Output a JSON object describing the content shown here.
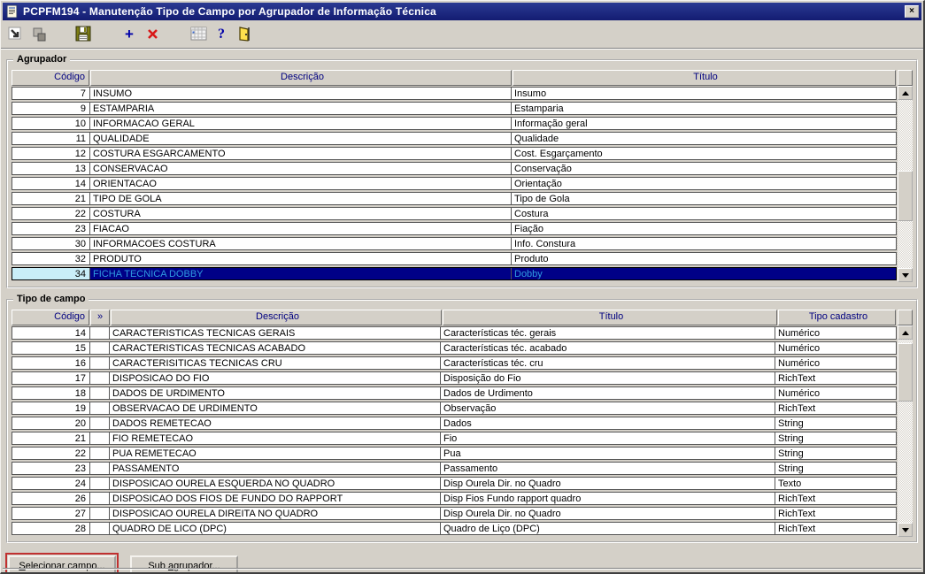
{
  "window": {
    "title": "PCPFM194 - Manutenção Tipo de Campo por Agrupador de Informação Técnica",
    "close_label": "×"
  },
  "toolbar": {
    "icons": [
      {
        "name": "window-arrow-icon"
      },
      {
        "name": "cascade-windows-icon"
      },
      {
        "name": "save-icon"
      },
      {
        "name": "add-icon"
      },
      {
        "name": "delete-icon"
      },
      {
        "name": "grid-icon"
      },
      {
        "name": "help-icon"
      },
      {
        "name": "exit-door-icon"
      }
    ],
    "add_glyph": "+",
    "help_glyph": "?"
  },
  "agrupador": {
    "label": "Agrupador",
    "columns": [
      "Código",
      "Descrição",
      "Título"
    ],
    "rows": [
      {
        "codigo": "7",
        "descricao": "INSUMO",
        "titulo": "Insumo"
      },
      {
        "codigo": "9",
        "descricao": "ESTAMPARIA",
        "titulo": "Estamparia"
      },
      {
        "codigo": "10",
        "descricao": "INFORMACAO GERAL",
        "titulo": "Informação geral"
      },
      {
        "codigo": "11",
        "descricao": "QUALIDADE",
        "titulo": "Qualidade"
      },
      {
        "codigo": "12",
        "descricao": "COSTURA ESGARCAMENTO",
        "titulo": "Cost. Esgarçamento"
      },
      {
        "codigo": "13",
        "descricao": "CONSERVACAO",
        "titulo": "Conservação"
      },
      {
        "codigo": "14",
        "descricao": "ORIENTACAO",
        "titulo": "Orientação"
      },
      {
        "codigo": "21",
        "descricao": "TIPO DE GOLA",
        "titulo": "Tipo de Gola"
      },
      {
        "codigo": "22",
        "descricao": "COSTURA",
        "titulo": "Costura"
      },
      {
        "codigo": "23",
        "descricao": "FIACAO",
        "titulo": "Fiação"
      },
      {
        "codigo": "30",
        "descricao": "INFORMACOES COSTURA",
        "titulo": "Info. Constura"
      },
      {
        "codigo": "32",
        "descricao": "PRODUTO",
        "titulo": "Produto"
      },
      {
        "codigo": "34",
        "descricao": "FICHA TECNICA DOBBY",
        "titulo": "Dobby",
        "selected": true
      }
    ]
  },
  "tipo_de_campo": {
    "label": "Tipo de campo",
    "columns": [
      "Código",
      "»",
      "Descrição",
      "Título",
      "Tipo cadastro"
    ],
    "rows": [
      {
        "codigo": "14",
        "chev": "",
        "descricao": "CARACTERISTICAS TECNICAS GERAIS",
        "titulo": "Características téc. gerais",
        "tipo": "Numérico"
      },
      {
        "codigo": "15",
        "chev": "",
        "descricao": "CARACTERISTICAS TECNICAS ACABADO",
        "titulo": "Características téc. acabado",
        "tipo": "Numérico"
      },
      {
        "codigo": "16",
        "chev": "",
        "descricao": "CARACTERISITICAS TECNICAS CRU",
        "titulo": "Características téc. cru",
        "tipo": "Numérico"
      },
      {
        "codigo": "17",
        "chev": "",
        "descricao": "DISPOSICAO DO FIO",
        "titulo": "Disposição do Fio",
        "tipo": "RichText"
      },
      {
        "codigo": "18",
        "chev": "",
        "descricao": "DADOS DE URDIMENTO",
        "titulo": "Dados de Urdimento",
        "tipo": "Numérico"
      },
      {
        "codigo": "19",
        "chev": "",
        "descricao": "OBSERVACAO DE URDIMENTO",
        "titulo": "Observação",
        "tipo": "RichText"
      },
      {
        "codigo": "20",
        "chev": "",
        "descricao": "DADOS REMETECAO",
        "titulo": "Dados",
        "tipo": "String"
      },
      {
        "codigo": "21",
        "chev": "",
        "descricao": "FIO REMETECAO",
        "titulo": "Fio",
        "tipo": "String"
      },
      {
        "codigo": "22",
        "chev": "",
        "descricao": "PUA REMETECAO",
        "titulo": "Pua",
        "tipo": "String"
      },
      {
        "codigo": "23",
        "chev": "",
        "descricao": "PASSAMENTO",
        "titulo": "Passamento",
        "tipo": "String"
      },
      {
        "codigo": "24",
        "chev": "",
        "descricao": "DISPOSICAO OURELA ESQUERDA NO QUADRO",
        "titulo": "Disp Ourela Dir. no Quadro",
        "tipo": "Texto"
      },
      {
        "codigo": "26",
        "chev": "",
        "descricao": "DISPOSICAO DOS FIOS DE FUNDO DO RAPPORT",
        "titulo": "Disp Fios Fundo rapport quadro",
        "tipo": "RichText"
      },
      {
        "codigo": "27",
        "chev": "",
        "descricao": "DISPOSICAO OURELA DIREITA NO QUADRO",
        "titulo": "Disp Ourela Dir. no Quadro",
        "tipo": "RichText"
      },
      {
        "codigo": "28",
        "chev": "",
        "descricao": "QUADRO DE LICO (DPC)",
        "titulo": "Quadro de Liço (DPC)",
        "tipo": "RichText"
      }
    ]
  },
  "buttons": {
    "selecionar": {
      "pre": "",
      "mnemonic": "S",
      "post": "elecionar campo..."
    },
    "sub": {
      "pre": "Sub ",
      "mnemonic": "a",
      "post": "grupador..."
    }
  },
  "colors": {
    "titlebar": "#1c2580",
    "header_text": "#000080",
    "selected_row_bg": "#000087",
    "selected_row_text": "#2f9be0",
    "selected_code_bg": "#c9eef8",
    "annotation_highlight": "#c03030",
    "add_icon": "#0000aa",
    "delete_icon": "#d81818"
  }
}
